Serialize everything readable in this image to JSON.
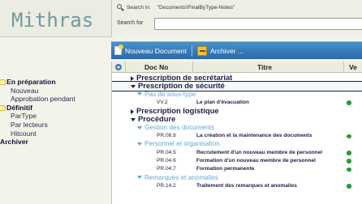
{
  "app": {
    "title": "Mithras"
  },
  "search": {
    "in_label": "Search in:",
    "in_path": "\"Documents\\FinalByType-Notes\"",
    "for_label": "Search for",
    "value": ""
  },
  "sidebar": {
    "sections": [
      {
        "label": "En préparation",
        "items": [
          "Nouveau",
          "Approbation pendant"
        ]
      },
      {
        "label": "Définitif",
        "items": [
          "ParType",
          "Par lecteurs",
          "Hitcount"
        ]
      }
    ],
    "archive_label": "Archiver"
  },
  "toolbar": {
    "new_doc_label": "Nouveau Document",
    "archive_label": "Archiver ..."
  },
  "table": {
    "columns": [
      "Doc No",
      "Titre",
      "Ve"
    ],
    "rows": [
      {
        "type": "group",
        "level": 1,
        "expanded": false,
        "label": "Prescription de secrétariat"
      },
      {
        "type": "group",
        "level": 1,
        "expanded": true,
        "label": "Prescription de sécurité",
        "selected": true
      },
      {
        "type": "group",
        "level": 2,
        "expanded": true,
        "label": "Pas de sous-type"
      },
      {
        "type": "doc",
        "code": "VV.2",
        "title": "Le plan d'évacuation",
        "status": true
      },
      {
        "type": "group",
        "level": 1,
        "expanded": false,
        "label": "Prescription logistique"
      },
      {
        "type": "group",
        "level": 1,
        "expanded": true,
        "label": "Procédure"
      },
      {
        "type": "group",
        "level": 2,
        "expanded": true,
        "label": "Gestion des documents"
      },
      {
        "type": "doc",
        "code": "PR.08.8",
        "title": "La création et la maintenance des documents",
        "status": true
      },
      {
        "type": "group",
        "level": 2,
        "expanded": true,
        "label": "Personnel et organisation"
      },
      {
        "type": "doc",
        "code": "PR.04.5",
        "title": "Recrutement d'un nouveau membre de personnel",
        "status": true
      },
      {
        "type": "doc",
        "code": "PR.04.6",
        "title": "Formation d'un nouveau membre de personnel",
        "status": true
      },
      {
        "type": "doc",
        "code": "PR.04.7",
        "title": "Formation permanente",
        "status": true
      },
      {
        "type": "group",
        "level": 2,
        "expanded": true,
        "label": "Remarques et anomalies"
      },
      {
        "type": "doc",
        "code": "PR.14.2",
        "title": "Traitement des remarques et anomalies",
        "status": true
      }
    ]
  },
  "colors": {
    "logo": "#6f9a9e",
    "toolbar": "#2a69a8",
    "subgroup": "#5fa8cf",
    "status_ok": "#2a9a3a",
    "folder": "#d9b91f"
  },
  "icons": [
    "search-icon",
    "folder-icon",
    "new-document-icon",
    "archive-icon",
    "sort-icon",
    "expand-triangle-icon",
    "status-dot-icon"
  ]
}
